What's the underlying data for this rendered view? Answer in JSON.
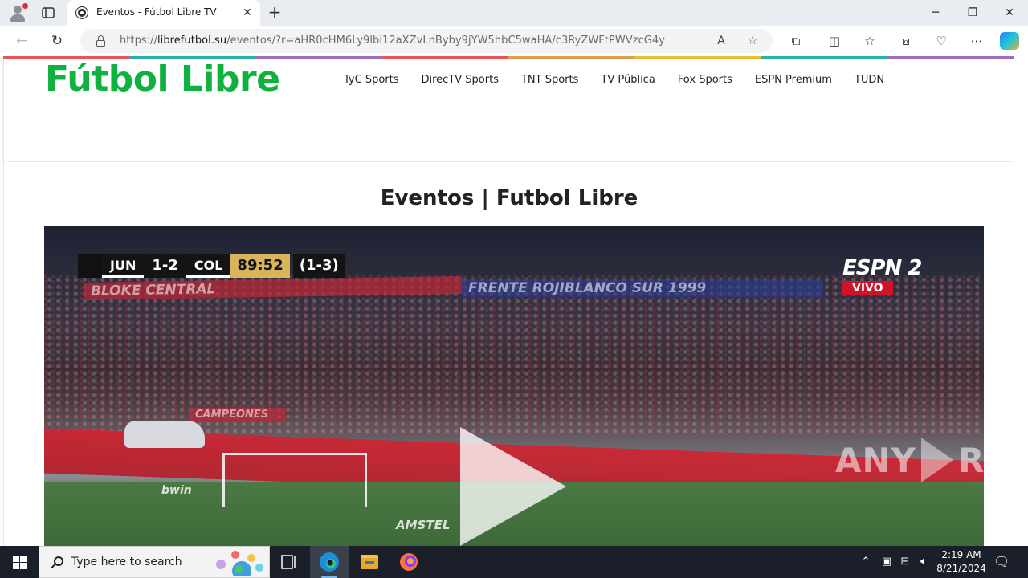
{
  "browser": {
    "tab": {
      "title": "Eventos - Fútbol Libre TV"
    },
    "address": {
      "prefix": "https://",
      "host": "librefutbol.su",
      "path": "/eventos/?r=aHR0cHM6Ly9lbi12aXZvLnByby9jYW5hbC5waHA/c3RyZWFtPWVzcG4y"
    }
  },
  "site": {
    "logo": "Fútbol Libre",
    "menu": [
      "TyC Sports",
      "DirecTV Sports",
      "TNT Sports",
      "TV Pública",
      "Fox Sports",
      "ESPN Premium",
      "TUDN"
    ],
    "heading": "Eventos | Futbol Libre",
    "rainbow_colors": [
      "#e8555a",
      "#2bb3a8",
      "#a16fc4",
      "#e8555a",
      "#e0a050",
      "#e6c23a",
      "#2bb3a8",
      "#a16fc4"
    ]
  },
  "video": {
    "scorebug": {
      "home": "JUN",
      "score": "1-2",
      "away": "COL",
      "clock": "89:52",
      "aggregate": "(1-3)"
    },
    "channel": {
      "brand": "ESPN 2",
      "live": "VIVO"
    },
    "banners": [
      "BLOKE CENTRAL",
      "FRENTE ROJIBLANCO SUR 1999",
      "CAMPEONES",
      "AMSTEL",
      "bwin"
    ]
  },
  "watermark": {
    "left": "ANY",
    "right": "RUN"
  },
  "taskbar": {
    "search_placeholder": "Type here to search",
    "time": "2:19 AM",
    "date": "8/21/2024"
  },
  "colors": {
    "logo_green": "#10b23f",
    "taskbar": "#1b1f2a",
    "accent_blue": "#76b9ed"
  }
}
